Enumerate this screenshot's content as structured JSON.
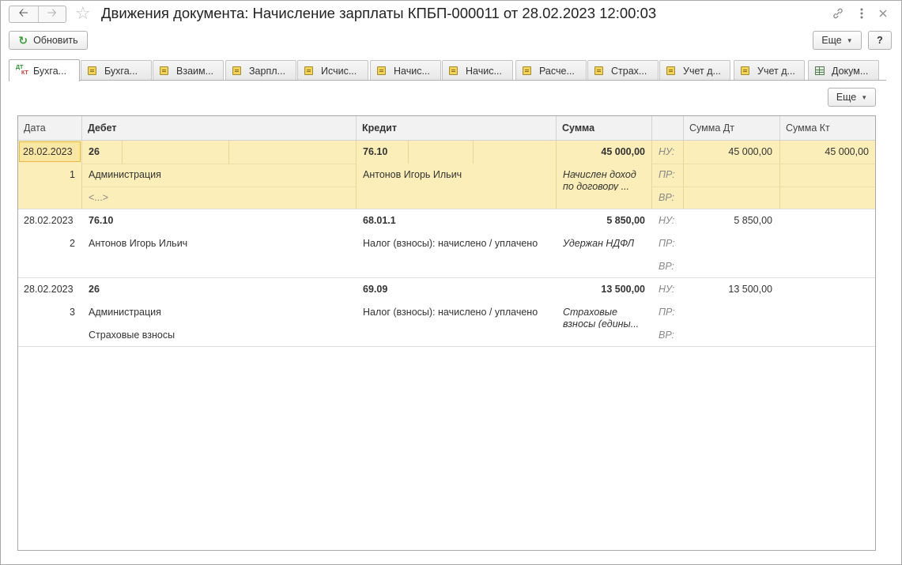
{
  "window": {
    "title": "Движения документа: Начисление зарплаты КПБП-000011 от 28.02.2023 12:00:03",
    "back_icon": "arrow-left-icon",
    "forward_icon": "arrow-right-icon",
    "favorite_icon": "star-icon",
    "link_icon": "link-icon",
    "menu_icon": "kebab-menu-icon",
    "close_icon": "close-icon"
  },
  "toolbar": {
    "refresh_label": "Обновить",
    "more_label": "Еще",
    "help_label": "?"
  },
  "tabs": [
    {
      "label": "Бухгалтерский и налоговый учет",
      "short": "Бухга...",
      "icon": "dt-kt-icon",
      "active": true
    },
    {
      "label": "Бухгалтерский учет",
      "short": "Бухга...",
      "icon": "register-icon"
    },
    {
      "label": "Взаиморасчеты",
      "short": "Взаим...",
      "icon": "register-icon"
    },
    {
      "label": "Зарплата",
      "short": "Зарпл...",
      "icon": "register-icon"
    },
    {
      "label": "Исчисленный НДФЛ",
      "short": "Исчис...",
      "icon": "register-icon"
    },
    {
      "label": "Начисления",
      "short": "Начис...",
      "icon": "register-icon"
    },
    {
      "label": "Начисления",
      "short": "Начис...",
      "icon": "register-icon"
    },
    {
      "label": "Расчеты",
      "short": "Расче...",
      "icon": "register-icon"
    },
    {
      "label": "Страховые взносы",
      "short": "Страх...",
      "icon": "register-icon"
    },
    {
      "label": "Учет доходов",
      "short": "Учет д...",
      "icon": "register-icon"
    },
    {
      "label": "Учет доходов",
      "short": "Учет д...",
      "icon": "register-icon"
    },
    {
      "label": "Документы",
      "short": "Докум...",
      "icon": "table-icon"
    }
  ],
  "panel": {
    "more_label": "Еще"
  },
  "grid": {
    "columns": {
      "date": "Дата",
      "debit": "Дебет",
      "credit": "Кредит",
      "sum": "Сумма",
      "sum_dt": "Сумма Дт",
      "sum_kt": "Сумма Кт"
    },
    "rows": [
      {
        "date": "28.02.2023",
        "num": "1",
        "debit_account": "26",
        "debit_sub1": "Администрация",
        "debit_sub2": "<...>",
        "credit_account": "76.10",
        "credit_sub1": "Антонов Игорь Ильич",
        "amount": "45 000,00",
        "content": "Начислен доход по договору ...",
        "nu_label": "НУ:",
        "pr_label": "ПР:",
        "vr_label": "ВР:",
        "nu_dt": "45 000,00",
        "nu_kt": "45 000,00"
      },
      {
        "date": "28.02.2023",
        "num": "2",
        "debit_account": "76.10",
        "debit_sub1": "Антонов Игорь Ильич",
        "credit_account": "68.01.1",
        "credit_sub1": "Налог (взносы): начислено / уплачено",
        "amount": "5 850,00",
        "content": "Удержан НДФЛ",
        "nu_label": "НУ:",
        "pr_label": "ПР:",
        "vr_label": "ВР:",
        "nu_dt": "5 850,00"
      },
      {
        "date": "28.02.2023",
        "num": "3",
        "debit_account": "26",
        "debit_sub1": "Администрация",
        "debit_sub2": "Страховые взносы",
        "credit_account": "69.09",
        "credit_sub1": "Налог (взносы): начислено / уплачено",
        "amount": "13 500,00",
        "content": "Страховые взносы (едины...",
        "nu_label": "НУ:",
        "pr_label": "ПР:",
        "vr_label": "ВР:",
        "nu_dt": "13 500,00"
      }
    ]
  }
}
